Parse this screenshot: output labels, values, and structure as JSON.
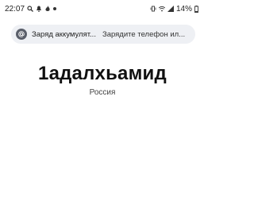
{
  "status_bar": {
    "time": "22:07",
    "battery_percent": "14%",
    "icons": [
      "search-icon",
      "notification-icon",
      "fire-icon",
      "dot-icon",
      "vibrate-icon",
      "wifi-icon",
      "signal-icon",
      "battery-icon"
    ]
  },
  "notification": {
    "icon": "at-sign-icon",
    "title": "Заряд аккумулят...",
    "text": "Зарядите телефон ил..."
  },
  "profile": {
    "name": "1адалхьамид",
    "country": "Россия"
  },
  "colors": {
    "background": "#ffffff",
    "notification_bg": "#eef0f4",
    "text": "#111111"
  }
}
